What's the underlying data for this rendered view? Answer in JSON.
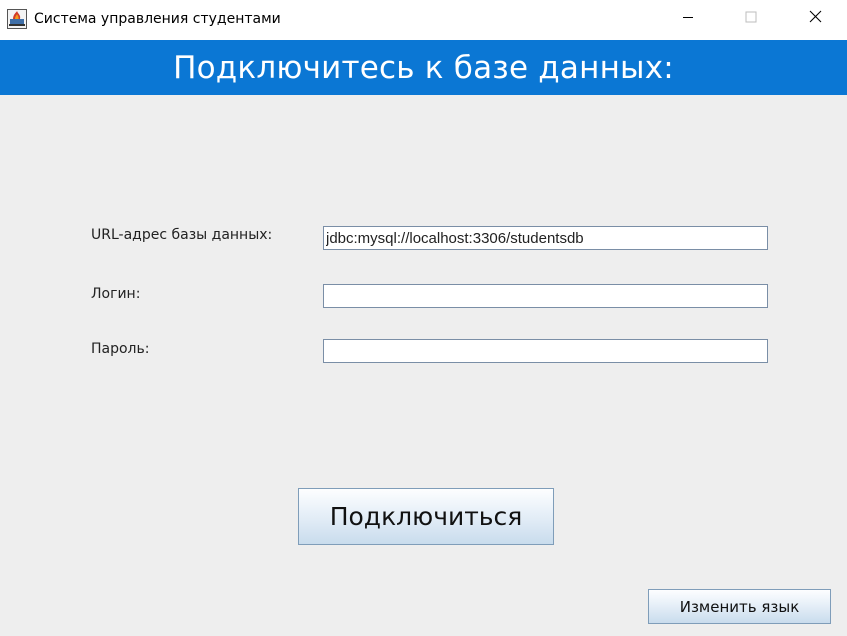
{
  "window": {
    "title": "Система управления студентами",
    "icon": "java-app-icon",
    "controls": [
      "minimize-icon",
      "maximize-icon",
      "close-icon"
    ]
  },
  "header": {
    "title": "Подключитесь к базе данных:",
    "background_color": "#0b77d4"
  },
  "form": {
    "url_label": "URL-адрес базы данных:",
    "url_value": "jdbc:mysql://localhost:3306/studentsdb",
    "login_label": "Логин:",
    "login_value": "",
    "password_label": "Пароль:",
    "password_value": ""
  },
  "buttons": {
    "connect_label": "Подключиться",
    "change_language_label": "Изменить язык"
  }
}
